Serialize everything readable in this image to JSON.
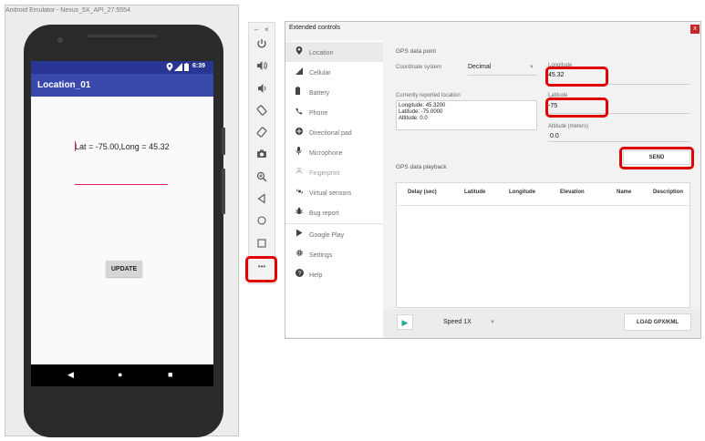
{
  "emulator": {
    "window_title": "Android Emulator - Nexus_5X_API_27:5554",
    "status_time": "6:39",
    "app_title": "Location_01",
    "latlong_text": "Lat = -75.00,Long = 45.32",
    "update_button": "UPDATE",
    "nav": {
      "back": "◀",
      "home": "●",
      "recents": "■"
    }
  },
  "toolbar": {
    "minimize": "–",
    "close": "×",
    "icons": [
      "power-icon",
      "volume-up-icon",
      "volume-down-icon",
      "rotate-left-icon",
      "rotate-right-icon",
      "camera-icon",
      "zoom-icon",
      "back-icon",
      "home-icon",
      "overview-icon",
      "more-icon"
    ],
    "more_label": "•••"
  },
  "extended": {
    "title": "Extended controls",
    "close": "x",
    "sidebar": [
      {
        "label": "Location",
        "icon": "location-pin-icon",
        "selected": true
      },
      {
        "label": "Cellular",
        "icon": "signal-icon"
      },
      {
        "label": "Battery",
        "icon": "battery-icon"
      },
      {
        "label": "Phone",
        "icon": "phone-icon"
      },
      {
        "label": "Directional pad",
        "icon": "dpad-icon"
      },
      {
        "label": "Microphone",
        "icon": "microphone-icon"
      },
      {
        "label": "Fingerprint",
        "icon": "fingerprint-icon",
        "muted": true
      },
      {
        "label": "Virtual sensors",
        "icon": "sensors-icon"
      },
      {
        "label": "Bug report",
        "icon": "bug-icon"
      },
      {
        "label": "Google Play",
        "icon": "play-store-icon"
      },
      {
        "label": "Settings",
        "icon": "settings-icon"
      },
      {
        "label": "Help",
        "icon": "help-icon"
      }
    ],
    "gps_title": "GPS data point",
    "coord_label": "Coordinate system",
    "coord_value": "Decimal",
    "longitude_label": "Longitude",
    "longitude_value": "45.32",
    "latitude_label": "Latitude",
    "latitude_value": "-75",
    "altitude_label": "Altitude (meters)",
    "altitude_value": "0.0",
    "reported_label": "Currently reported location",
    "reported": {
      "longitude": "Longitude: 45.3200",
      "latitude": "Latitude: -75.0000",
      "altitude": "Altitude: 0.0"
    },
    "send_button": "SEND",
    "playback_title": "GPS data playback",
    "columns": [
      "Delay (sec)",
      "Latitude",
      "Longitude",
      "Elevation",
      "Name",
      "Description"
    ],
    "speed_label": "Speed 1X",
    "load_button": "LOAD GPX/KML"
  },
  "colors": {
    "app_bar": "#3949ab",
    "status_bar": "#283593",
    "highlight": "#e00000",
    "accent": "#e91e63",
    "play": "#26a69a"
  }
}
